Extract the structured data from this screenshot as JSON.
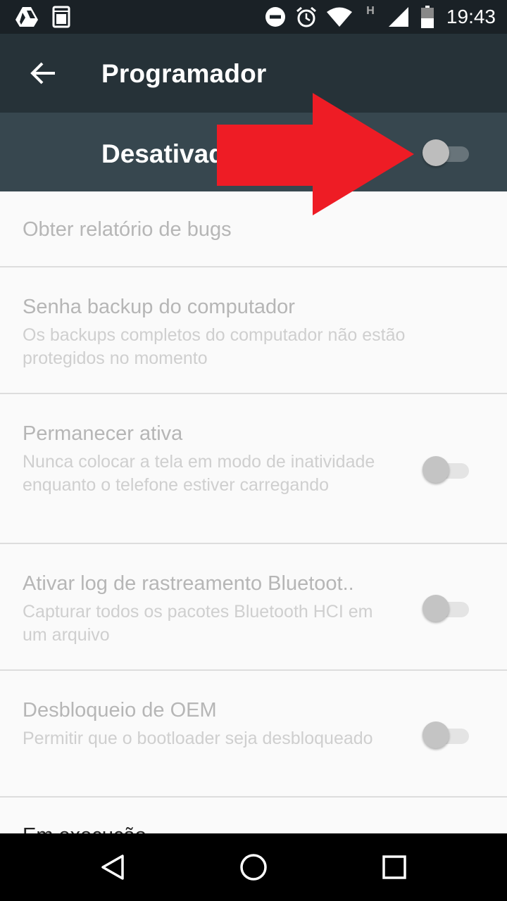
{
  "status_bar": {
    "time": "19:43",
    "icons": [
      "drive-icon",
      "bag-icon",
      "do-not-disturb-icon",
      "alarm-icon",
      "wifi-icon",
      "h-network-icon",
      "signal-icon",
      "battery-icon"
    ],
    "network_label": "H"
  },
  "app_bar": {
    "title": "Programador",
    "back_icon": "arrow-back-icon"
  },
  "master_toggle": {
    "label": "Desativado",
    "state": "off"
  },
  "settings": [
    {
      "title": "Obter relatório de bugs",
      "subtitle": "",
      "has_switch": false
    },
    {
      "title": "Senha backup do computador",
      "subtitle": "Os backups completos do computador não estão protegidos no momento",
      "has_switch": false
    },
    {
      "title": "Permanecer ativa",
      "subtitle": "Nunca colocar a tela em modo de inatividade enquanto o telefone estiver carregando",
      "has_switch": true,
      "state": "off"
    },
    {
      "title": "Ativar log de rastreamento Bluetoot..",
      "subtitle": "Capturar todos os pacotes Bluetooth HCI em um arquivo",
      "has_switch": true,
      "state": "off"
    },
    {
      "title": "Desbloqueio de OEM",
      "subtitle": "Permitir que o bootloader seja desbloqueado",
      "has_switch": true,
      "state": "off"
    },
    {
      "title": "Em execução",
      "subtitle": "",
      "has_switch": false
    }
  ],
  "nav_bar": {
    "buttons": [
      "back-triangle-icon",
      "home-circle-icon",
      "recents-square-icon"
    ]
  },
  "colors": {
    "status_bar": "#1a2126",
    "app_bar": "#263238",
    "master_bar": "#37474f",
    "list_bg": "#fafafa",
    "annotation_arrow": "#ee1c25"
  }
}
